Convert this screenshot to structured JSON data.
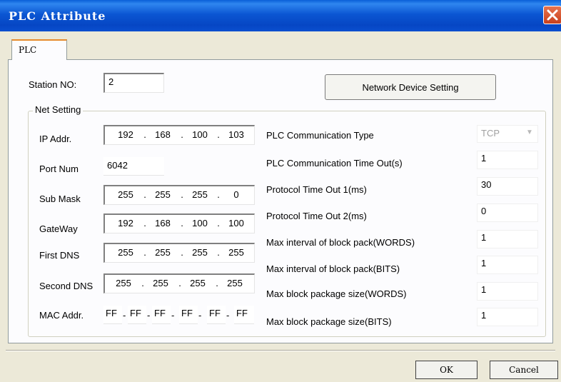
{
  "window": {
    "title": "PLC Attribute",
    "close_icon": "close-x-icon"
  },
  "tabs": [
    {
      "label": "PLC",
      "selected": true
    }
  ],
  "station": {
    "label": "Station NO:",
    "value": "2"
  },
  "network_device_button": "Network Device Setting",
  "net_setting": {
    "group_title": "Net Setting",
    "ip_addr": {
      "label": "IP Addr.",
      "octets": [
        "192",
        "168",
        "100",
        "103"
      ]
    },
    "port_num": {
      "label": "Port Num",
      "value": "6042"
    },
    "sub_mask": {
      "label": "Sub Mask",
      "octets": [
        "255",
        "255",
        "255",
        "0"
      ]
    },
    "gateway": {
      "label": "GateWay",
      "octets": [
        "192",
        "168",
        "100",
        "100"
      ]
    },
    "first_dns": {
      "label": "First DNS",
      "octets": [
        "255",
        "255",
        "255",
        "255"
      ]
    },
    "second_dns": {
      "label": "Second DNS",
      "octets": [
        "255",
        "255",
        "255",
        "255"
      ]
    },
    "mac_addr": {
      "label": "MAC Addr.",
      "bytes": [
        "FF",
        "FF",
        "FF",
        "FF",
        "FF",
        "FF"
      ],
      "separator": "-"
    }
  },
  "plc_settings": {
    "comm_type": {
      "label": "PLC Communication Type",
      "value": "TCP"
    },
    "comm_timeout": {
      "label": "PLC Communication Time Out(s)",
      "value": "1"
    },
    "protocol_timeout_1": {
      "label": "Protocol Time Out 1(ms)",
      "value": "30"
    },
    "protocol_timeout_2": {
      "label": "Protocol Time Out 2(ms)",
      "value": "0"
    },
    "max_interval_words": {
      "label": "Max interval of block pack(WORDS)",
      "value": "1"
    },
    "max_interval_bits": {
      "label": "Max interval of block pack(BITS)",
      "value": "1"
    },
    "max_size_words": {
      "label": "Max block package size(WORDS)",
      "value": "1"
    },
    "max_size_bits": {
      "label": "Max block package size(BITS)",
      "value": "1"
    }
  },
  "buttons": {
    "ok": "OK",
    "cancel": "Cancel"
  },
  "colors": {
    "titlebar": "#0b56d3",
    "dialog_background": "#ece9d8",
    "close_button": "#d9552f",
    "tab_highlight": "#e68b2c"
  }
}
